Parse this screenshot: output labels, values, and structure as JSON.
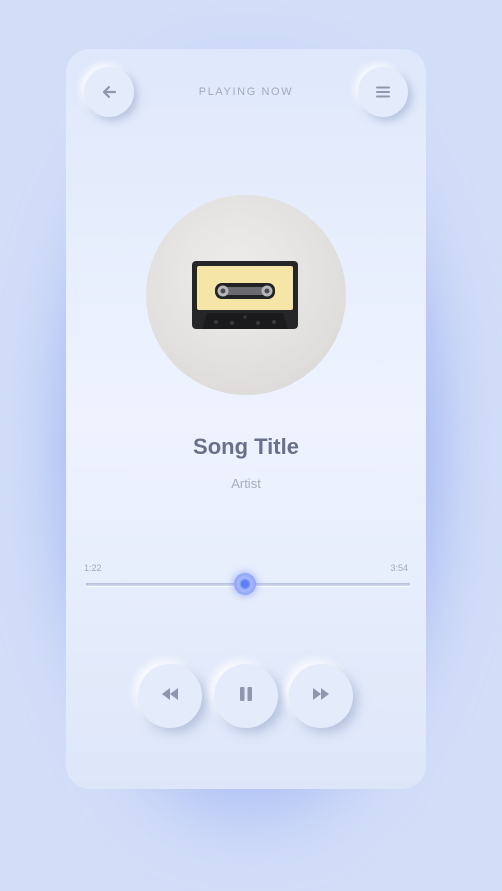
{
  "header": {
    "title": "PLAYING NOW",
    "back_icon": "arrow-left-icon",
    "menu_icon": "menu-icon"
  },
  "track": {
    "title": "Song Title",
    "artist": "Artist",
    "artwork": "cassette-tape-artwork"
  },
  "progress": {
    "elapsed": "1:22",
    "total": "3:54",
    "fraction": 0.49
  },
  "controls": {
    "rewind_icon": "rewind-icon",
    "pause_icon": "pause-icon",
    "forward_icon": "fast-forward-icon"
  },
  "colors": {
    "accent": "#5f7ef6",
    "background": "#d2def8",
    "card": "#e6edfb",
    "text": "#69708a"
  }
}
